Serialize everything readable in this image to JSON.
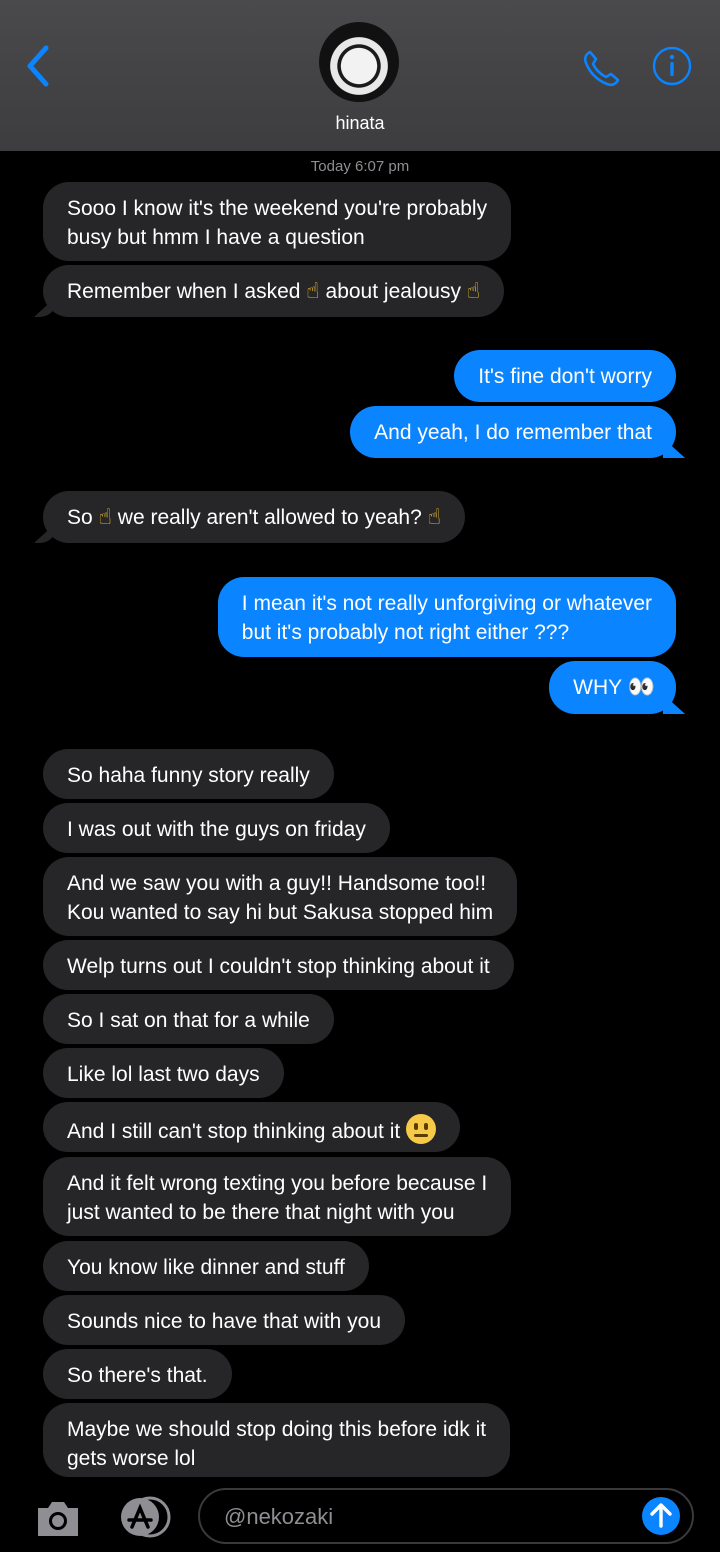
{
  "header": {
    "contact_name": "hinata"
  },
  "timestamp": "Today 6:07 pm",
  "messages": [
    {
      "line1": "Sooo I know it's the weekend you're probably",
      "line2": "busy but hmm I have a question"
    },
    {
      "pre": "Remember when I asked ",
      "mid": " about jealousy ",
      "emoji": "☝"
    },
    {
      "text": "It's fine don't worry"
    },
    {
      "text": "And yeah, I do remember that"
    },
    {
      "pre": "So ",
      "mid": " we really aren't allowed to yeah? ",
      "emoji": "☝"
    },
    {
      "line1": "I mean it's not really unforgiving or whatever",
      "line2": "but it's probably not right either ???"
    },
    {
      "text": "WHY ",
      "emoji": "👀"
    },
    {
      "text": "So haha funny story really"
    },
    {
      "text": "I was out with the guys on friday"
    },
    {
      "line1": "And we saw you with a guy!! Handsome too!!",
      "line2": "Kou wanted to say hi but Sakusa stopped him"
    },
    {
      "text": "Welp turns out I couldn't stop thinking about it"
    },
    {
      "text": "So I sat on that for a while"
    },
    {
      "text": "Like lol last two days"
    },
    {
      "text": "And I still can't stop thinking about it "
    },
    {
      "line1": "And it felt wrong texting you before because I",
      "line2": "just wanted to be there that night with you"
    },
    {
      "text": "You know like dinner and stuff"
    },
    {
      "text": "Sounds nice to have that with you"
    },
    {
      "text": "So there's that."
    },
    {
      "line1": "Maybe we should stop doing this before idk it",
      "line2": "gets worse lol"
    }
  ],
  "composer": {
    "placeholder": "@nekozaki"
  },
  "colors": {
    "accent": "#0a84ff",
    "incoming_bubble": "#262628",
    "header_bg": "#3d3d3f"
  },
  "icons": [
    "back-chevron-icon",
    "phone-icon",
    "info-icon",
    "camera-icon",
    "app-store-icon",
    "send-arrow-icon"
  ]
}
